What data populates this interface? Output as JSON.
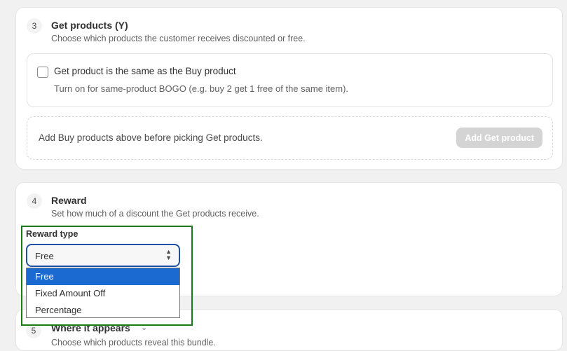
{
  "get_products": {
    "step": "3",
    "title": "Get products (Y)",
    "subtitle": "Choose which products the customer receives discounted or free.",
    "same_product": {
      "checked": false,
      "label": "Get product is the same as the Buy product",
      "help": "Turn on for same-product BOGO (e.g. buy 2 get 1 free of the same item)."
    },
    "picker": {
      "message": "Add Buy products above before picking Get products.",
      "button_label": "Add Get product",
      "button_disabled": true
    }
  },
  "reward": {
    "step": "4",
    "title": "Reward",
    "subtitle": "Set how much of a discount the Get products receive.",
    "type_label": "Reward type",
    "selected": "Free",
    "options": [
      "Free",
      "Fixed Amount Off",
      "Percentage"
    ]
  },
  "where_it_appears": {
    "step": "5",
    "title": "Where it appears",
    "subtitle": "Choose which products reveal this bundle."
  },
  "colors": {
    "highlight": "#1a7a1a",
    "focus_ring": "#1f4fa8",
    "option_selected": "#1a6ad2"
  },
  "icons": {
    "select": "chevron-up-down-icon",
    "collapse": "chevron-down-icon"
  }
}
